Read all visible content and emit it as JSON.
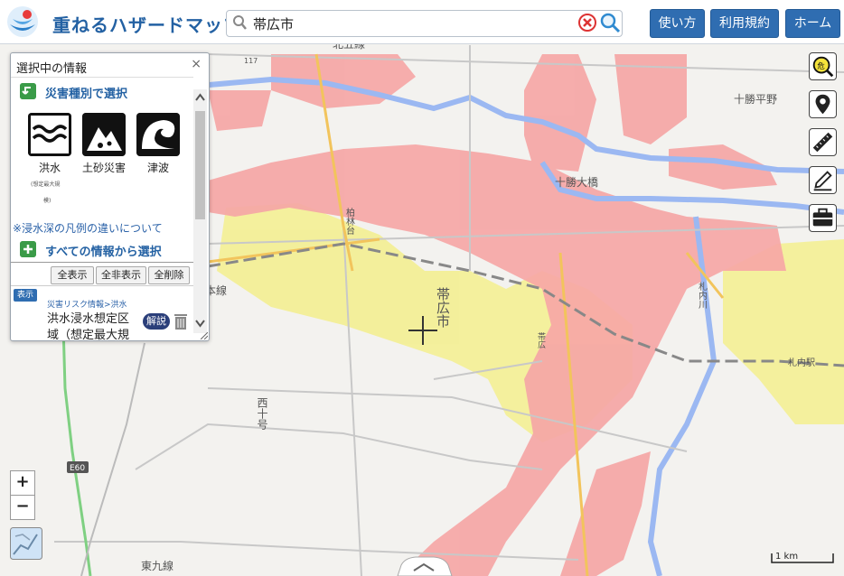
{
  "header": {
    "title": "重ねるハザードマップ",
    "search": {
      "value": "帯広市",
      "placeholder": ""
    },
    "buttons": [
      "使い方",
      "利用規約",
      "ホーム"
    ]
  },
  "panel": {
    "title": "選択中の情報",
    "close": "×",
    "section_select_by_type": "災害種別で選択",
    "hazards": [
      {
        "label": "洪水",
        "note_line1": "(想定最大規",
        "note_line2": "模)"
      },
      {
        "label": "土砂災害"
      },
      {
        "label": "津波"
      }
    ],
    "depth_note": "※浸水深の凡例の違いについて",
    "section_all": "すべての情報から選択",
    "buttons": [
      "全表示",
      "全非表示",
      "全削除"
    ],
    "layer": {
      "badge": "表示",
      "path": "災害リスク情報>洪水",
      "name": "洪水浸水想定区域（想定最大規",
      "kaisetsu": "解説"
    }
  },
  "map_labels": {
    "kita5": "北五線",
    "tokachi_heiya": "十勝平野",
    "tokachi_ohashi": "十勝大橋",
    "kashiwabayashidai": "柏林台",
    "obihiro": "帯広市",
    "hon": "本線",
    "nishi10": "西十号",
    "e60": "E60",
    "higashi9": "東九線",
    "satsunai_river": "札内川",
    "satsunai_station": "札内駅",
    "route": "117",
    "center_station": "帯広"
  },
  "zoom": {
    "in": "+",
    "out": "−"
  },
  "scale": "1 km",
  "colors": {
    "accent": "#2f6db1",
    "flood_pink": "#f7a8a8",
    "flood_yellow": "#f5ef8f",
    "river": "#9bb7f0"
  }
}
